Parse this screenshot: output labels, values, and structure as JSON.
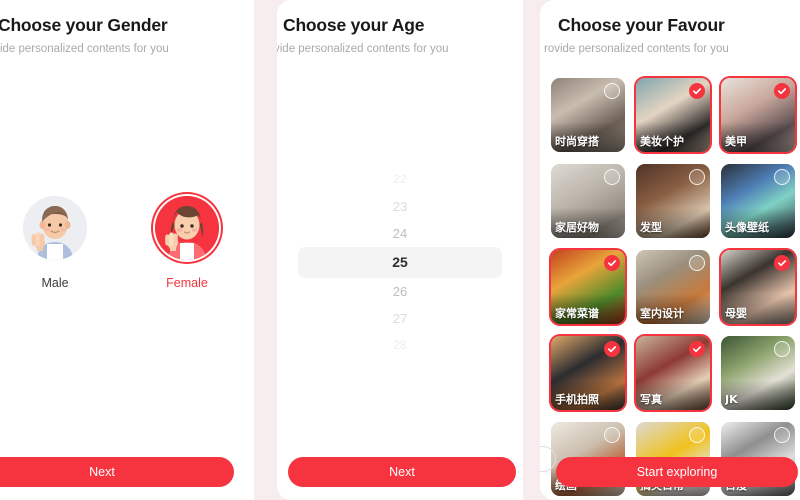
{
  "app": {
    "accent_color": "#f6343f",
    "page_background": "#f7ecee",
    "panel_background": "#ffffff"
  },
  "gender_panel": {
    "title": "Choose your Gender",
    "subtitle": "rovide personalized contents for you",
    "options": [
      {
        "label": "Male",
        "icon": "male-avatar-icon",
        "selected": false
      },
      {
        "label": "Female",
        "icon": "female-avatar-icon",
        "selected": true
      }
    ],
    "cta_label": "Next"
  },
  "age_panel": {
    "title": "Choose your Age",
    "subtitle": "vide personalized contents for you",
    "values": [
      "22",
      "23",
      "24",
      "25",
      "26",
      "27",
      "28"
    ],
    "selected_value": "25",
    "cta_label": "Next"
  },
  "favour_panel": {
    "title": "Choose your Favour",
    "subtitle": "rovide personalized contents for you",
    "tiles": [
      {
        "label": "时尚穿搭",
        "selected": false
      },
      {
        "label": "美妆个护",
        "selected": true
      },
      {
        "label": "美甲",
        "selected": true
      },
      {
        "label": "家居好物",
        "selected": false
      },
      {
        "label": "发型",
        "selected": false
      },
      {
        "label": "头像壁纸",
        "selected": false
      },
      {
        "label": "家常菜谱",
        "selected": true
      },
      {
        "label": "室内设计",
        "selected": false
      },
      {
        "label": "母婴",
        "selected": true
      },
      {
        "label": "手机拍照",
        "selected": true
      },
      {
        "label": "写真",
        "selected": true
      },
      {
        "label": "JK",
        "selected": false
      },
      {
        "label": "绘画",
        "selected": false
      },
      {
        "label": "搞笑日常",
        "selected": false
      },
      {
        "label": "日漫",
        "selected": false
      }
    ],
    "cta_label": "Start exploring"
  }
}
